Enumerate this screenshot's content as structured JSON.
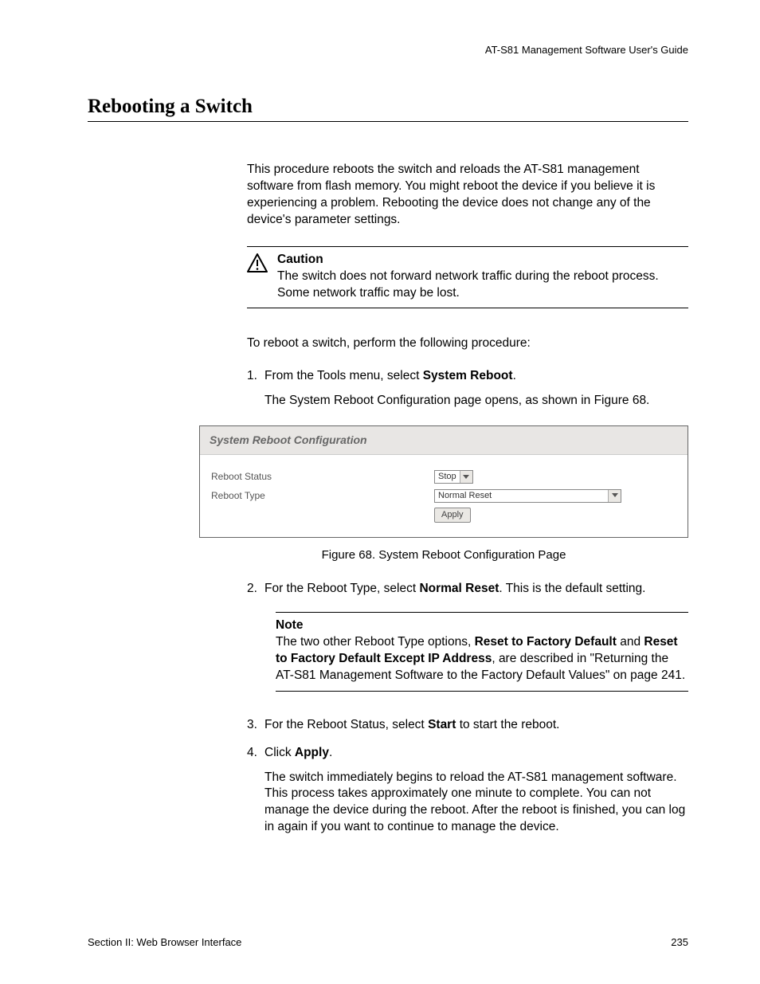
{
  "header": {
    "guide": "AT-S81 Management Software User's Guide"
  },
  "title": "Rebooting a Switch",
  "intro": "This procedure reboots the switch and reloads the AT-S81 management software from flash memory. You might reboot the device if you believe it is experiencing a problem. Rebooting the device does not change any of the device's parameter settings.",
  "caution": {
    "title": "Caution",
    "body": "The switch does not forward network traffic during the reboot process. Some network traffic may be lost."
  },
  "lead": "To reboot a switch, perform the following procedure:",
  "steps": {
    "s1": {
      "num": "1.",
      "text_a": "From the Tools menu, select ",
      "bold": "System Reboot",
      "text_b": ".",
      "desc": "The System Reboot Configuration page opens, as shown in Figure 68."
    },
    "s2": {
      "num": "2.",
      "text_a": "For the Reboot Type, select ",
      "bold": "Normal Reset",
      "text_b": ". This is the default setting."
    },
    "s3": {
      "num": "3.",
      "text_a": "For the Reboot Status, select ",
      "bold": "Start",
      "text_b": " to start the reboot."
    },
    "s4": {
      "num": "4.",
      "text_a": "Click ",
      "bold": "Apply",
      "text_b": ".",
      "desc": "The switch immediately begins to reload the AT-S81 management software. This process takes approximately one minute to complete. You can not manage the device during the reboot. After the reboot is finished, you can log in again if you want to continue to manage the device."
    }
  },
  "figure": {
    "title": "System Reboot Configuration",
    "rows": {
      "status": {
        "label": "Reboot Status",
        "value": "Stop"
      },
      "type": {
        "label": "Reboot Type",
        "value": "Normal Reset"
      }
    },
    "apply": "Apply",
    "caption": "Figure 68. System Reboot Configuration Page"
  },
  "note": {
    "title": "Note",
    "text_a": "The two other Reboot Type options, ",
    "bold_a": "Reset to Factory Default",
    "text_b": " and ",
    "bold_b": "Reset to Factory Default Except IP Address",
    "text_c": ", are described in \"Returning the AT-S81 Management Software to the Factory Default Values\" on page 241."
  },
  "footer": {
    "section": "Section II: Web Browser Interface",
    "page": "235"
  }
}
